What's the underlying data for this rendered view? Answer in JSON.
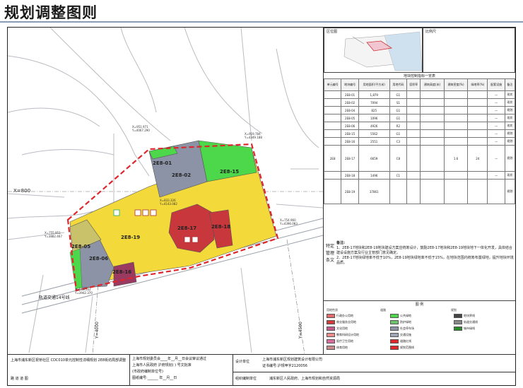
{
  "page_title": "规划调整图则",
  "map": {
    "coord_labels": [
      {
        "text": "X=951.971",
        "sub": "Y=4067.290"
      },
      {
        "text": "X=919.784",
        "sub": "Y=4349.188"
      },
      {
        "text": "X=833.326",
        "sub": "Y=4143.082"
      },
      {
        "text": "X=755.951",
        "sub": "Y=3882.467"
      },
      {
        "text": "X=754.960",
        "sub": "Y=4396.083"
      },
      {
        "text": "X=563.502",
        "sub": "Y=3942.370"
      }
    ],
    "axis_x": "X=800",
    "axis_y1": "Y=4000",
    "axis_y2": "Y=4500",
    "rail_label": "轨道交通14号线",
    "parcels": [
      "2E8-01",
      "2E8-02",
      "2E8-15",
      "2E8-19",
      "2E8-17",
      "2E8-18",
      "2E8-06",
      "2E8-16",
      "2E8-05"
    ],
    "colors": {
      "yellow": "#f3d93a",
      "green": "#4cd84a",
      "gray": "#8c93a6",
      "red": "#c8373c",
      "purple": "#9a3a60",
      "olive": "#c9c26a",
      "boundary": "#e0262b"
    }
  },
  "side": {
    "location_label": "区位图",
    "scale_label": "比例尺",
    "table_title": "地块控制指标一览表",
    "headers": [
      "单元编号",
      "地块编号",
      "用地面积(平方米)",
      "用地代码",
      "容积率",
      "建筑高度(米)",
      "建筑密度(%)",
      "绿地率(%)",
      "配套设施",
      "备注"
    ],
    "rows": [
      [
        "",
        "2E8-01",
        "1,879",
        "G1",
        "",
        "",
        "",
        "",
        "—",
        "现状"
      ],
      [
        "",
        "2E8-02",
        "7094",
        "S1",
        "",
        "",
        "",
        "",
        "—",
        "现状"
      ],
      [
        "",
        "2E8-04",
        "825",
        "G1",
        "",
        "",
        "",
        "",
        "—",
        "规划"
      ],
      [
        "",
        "2E8-05",
        "1096",
        "G1",
        "",
        "",
        "",
        "",
        "—",
        "现状"
      ],
      [
        "",
        "2E8-06",
        "4926",
        "R2",
        "",
        "",
        "",
        "",
        "—",
        "现状"
      ],
      [
        "",
        "2E8-15",
        "5562",
        "G1",
        "",
        "",
        "",
        "",
        "—",
        "规划"
      ],
      [
        "",
        "2E8-16",
        "2551",
        "C3",
        "",
        "",
        "",
        "",
        "—",
        "规划"
      ],
      [
        "2E8",
        "2E8-17",
        "6659",
        "C8",
        "",
        "",
        "1.6",
        "24",
        "—",
        "规划"
      ],
      [
        "",
        "2E8-18",
        "1496",
        "C1",
        "",
        "",
        "",
        "",
        "—",
        "现状"
      ],
      [
        "",
        "2E8-19",
        "37861",
        "",
        "",
        "",
        "",
        "",
        "",
        "规划"
      ]
    ],
    "vertical_title": "特定管理条文",
    "notes_title": "备注:",
    "notes": [
      "1、2E8-17地块和2E8-19地块建设方案应统筹设计，鼓励2E8-17地块和2E8-19地块地下一体化开发，具体结合建设设施方案及行业主管部门意见确定。",
      "2、2E8-17地块绿地率不低于10%，2E8-19地块绿地率不低于15%，在地块范围内统筹布置绿地，提升地块环境品质。"
    ],
    "legend_title": "图 例",
    "legend_groups": [
      "用地性质",
      "道路",
      "规划"
    ],
    "legend_items": [
      "行政办公用地",
      "商业服务业用地",
      "文化用地",
      "教育科研设计用地",
      "医疗卫生用地",
      "体育用地",
      "公共绿地",
      "防护绿地",
      "社会停车场",
      "交通设施",
      "道路红线",
      "规划范围线",
      "地块界线",
      "轨道交通线",
      "城市绿线"
    ]
  },
  "footer": {
    "project": "上海市浦东新区祝桥社区 CDC010单元控制性详细规划 2E8街坊局部调整",
    "approve_1": "上海市规划委员会____年__月__日会议审议通过",
    "approve_2": "上海市人民政府   沪府规划(  )  号文批准",
    "approve_3": "(市政府编制单位号)",
    "approve_4": "图纸编号:______ 年__月__日",
    "design_label": "设计单位",
    "design_unit": "上海市浦东新区规划建筑设计有限公司",
    "cert": "证书编号:沪规甲字2120056",
    "org_label": "组织编制单位",
    "org": "浦东新区人民政府、上海市规划和自然资源局",
    "date_label": "",
    "sign": "路 道 道 图"
  }
}
